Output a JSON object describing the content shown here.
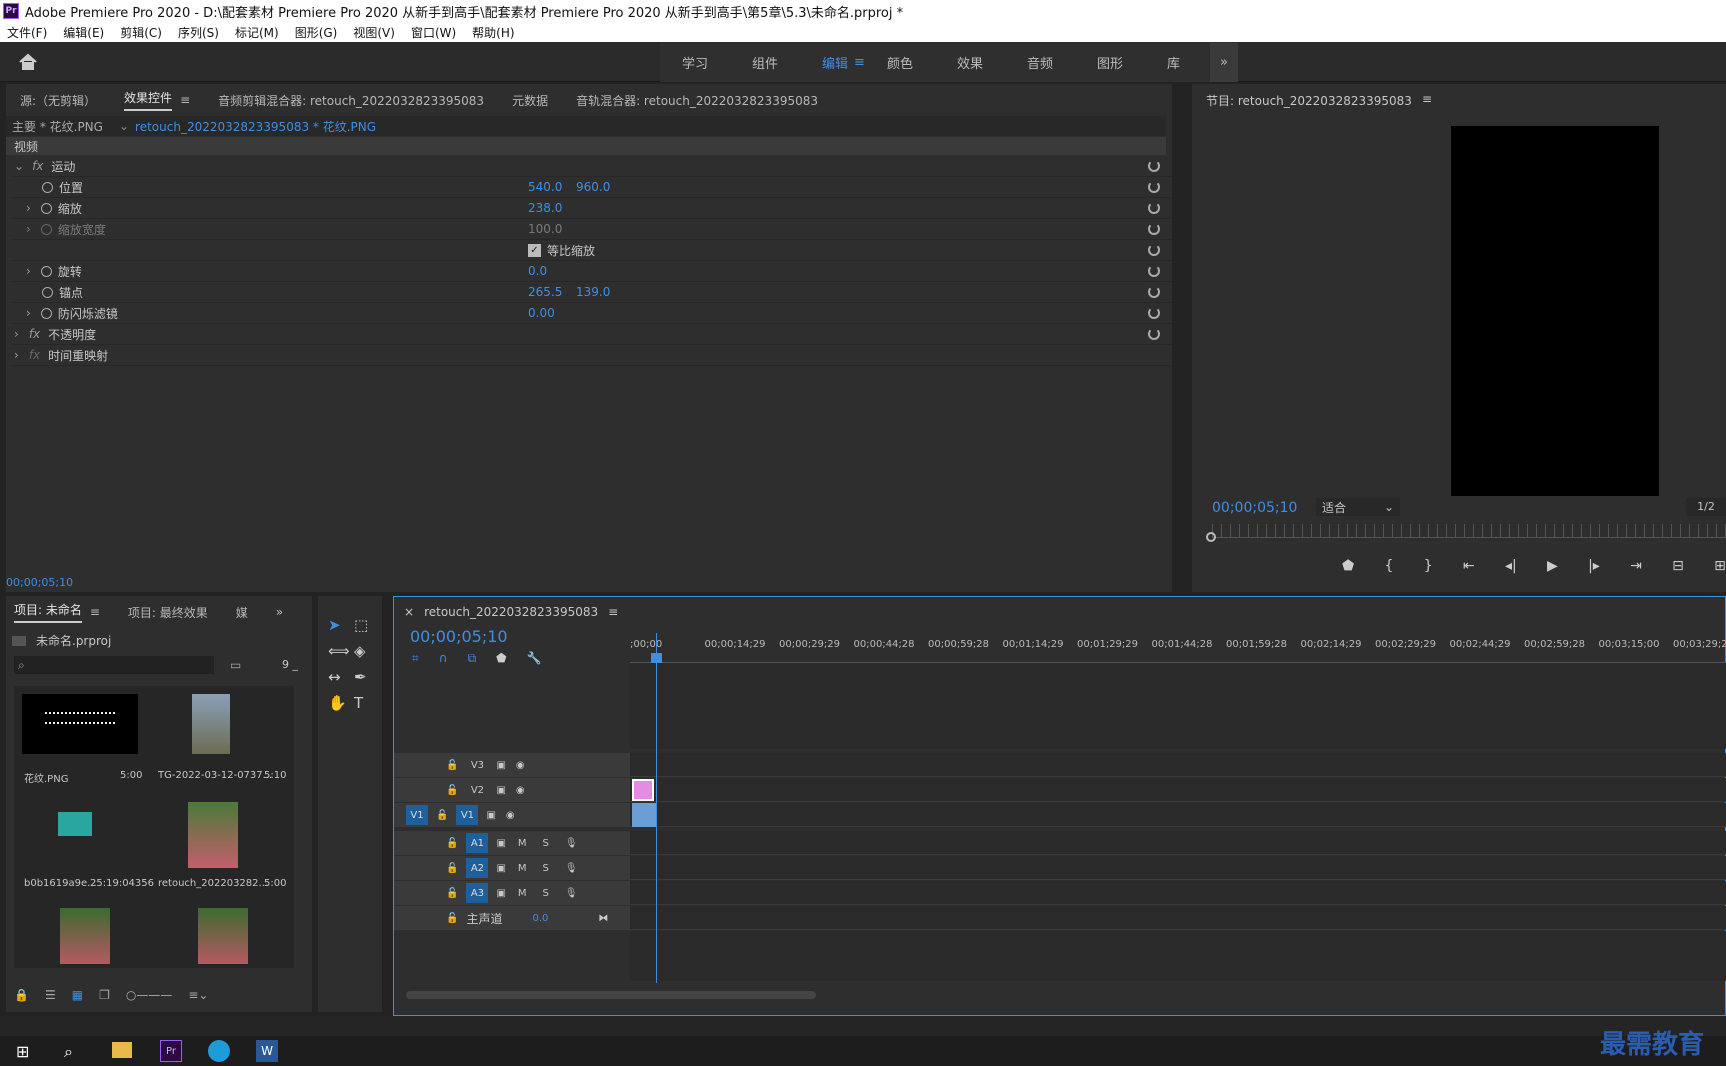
{
  "window": {
    "app_badge": "Pr",
    "title": "Adobe Premiere Pro 2020 - D:\\配套素材 Premiere Pro 2020 从新手到高手\\配套素材 Premiere Pro 2020 从新手到高手\\第5章\\5.3\\未命名.prproj *"
  },
  "menu": [
    "文件(F)",
    "编辑(E)",
    "剪辑(C)",
    "序列(S)",
    "标记(M)",
    "图形(G)",
    "视图(V)",
    "窗口(W)",
    "帮助(H)"
  ],
  "workspaces": [
    {
      "label": "学习",
      "active": false
    },
    {
      "label": "组件",
      "active": false
    },
    {
      "label": "编辑",
      "active": true
    },
    {
      "label": "颜色",
      "active": false
    },
    {
      "label": "效果",
      "active": false
    },
    {
      "label": "音频",
      "active": false
    },
    {
      "label": "图形",
      "active": false
    },
    {
      "label": "库",
      "active": false
    }
  ],
  "source_panel": {
    "tabs": [
      "源:（无剪辑）",
      "效果控件",
      "音频剪辑混合器: retouch_2022032823395083",
      "元数据",
      "音轨混合器: retouch_2022032823395083"
    ],
    "master_label": "主要 * 花纹.PNG",
    "clip_label": "retouch_2022032823395083 * 花纹.PNG",
    "section": "视频",
    "rows": [
      {
        "name": "运动",
        "v1": "",
        "v2": ""
      },
      {
        "name": "位置",
        "v1": "540.0",
        "v2": "960.0"
      },
      {
        "name": "缩放",
        "v1": "238.0",
        "v2": ""
      },
      {
        "name": "缩放宽度",
        "v1": "100.0",
        "v2": ""
      },
      {
        "name": "",
        "v1": "等比缩放",
        "v2": ""
      },
      {
        "name": "旋转",
        "v1": "0.0",
        "v2": ""
      },
      {
        "name": "锚点",
        "v1": "265.5",
        "v2": "139.0"
      },
      {
        "name": "防闪烁滤镜",
        "v1": "0.00",
        "v2": ""
      },
      {
        "name": "不透明度",
        "v1": "",
        "v2": ""
      },
      {
        "name": "时间重映射",
        "v1": "",
        "v2": ""
      }
    ],
    "timecode": "00;00;05;10"
  },
  "program": {
    "title": "节目: retouch_2022032823395083",
    "timecode": "00;00;05;10",
    "fit": "适合",
    "resolution": "1/2"
  },
  "project": {
    "tabs": [
      "项目: 未命名",
      "项目: 最终效果",
      "媒"
    ],
    "file": "未命名.prproj",
    "count": "9 _",
    "items": [
      {
        "name": "花纹.PNG",
        "dur": "5:00"
      },
      {
        "name": "TG-2022-03-12-0737...",
        "dur": "5:10"
      },
      {
        "name": "b0b1619a9e...",
        "dur": "25:19:04356"
      },
      {
        "name": "retouch_202203282...",
        "dur": "5:00"
      }
    ]
  },
  "timeline": {
    "sequence": "retouch_2022032823395083",
    "timecode": "00;00;05;10",
    "ruler": [
      ";00;00",
      "00;00;14;29",
      "00;00;29;29",
      "00;00;44;28",
      "00;00;59;28",
      "00;01;14;29",
      "00;01;29;29",
      "00;01;44;28",
      "00;01;59;28",
      "00;02;14;29",
      "00;02;29;29",
      "00;02;44;29",
      "00;02;59;28",
      "00;03;15;00",
      "00;03;29;29"
    ],
    "video_tracks": [
      "V3",
      "V2",
      "V1"
    ],
    "audio_tracks": [
      "A1",
      "A2",
      "A3"
    ],
    "source_target": "V1",
    "mute": "M",
    "solo": "S",
    "master": "主声道",
    "master_value": "0.0"
  },
  "watermark": "最需教育",
  "colors": {
    "accent": "#3d8fe6",
    "clip_v2": "#e58be6",
    "clip_v1": "#6b9ed4"
  }
}
